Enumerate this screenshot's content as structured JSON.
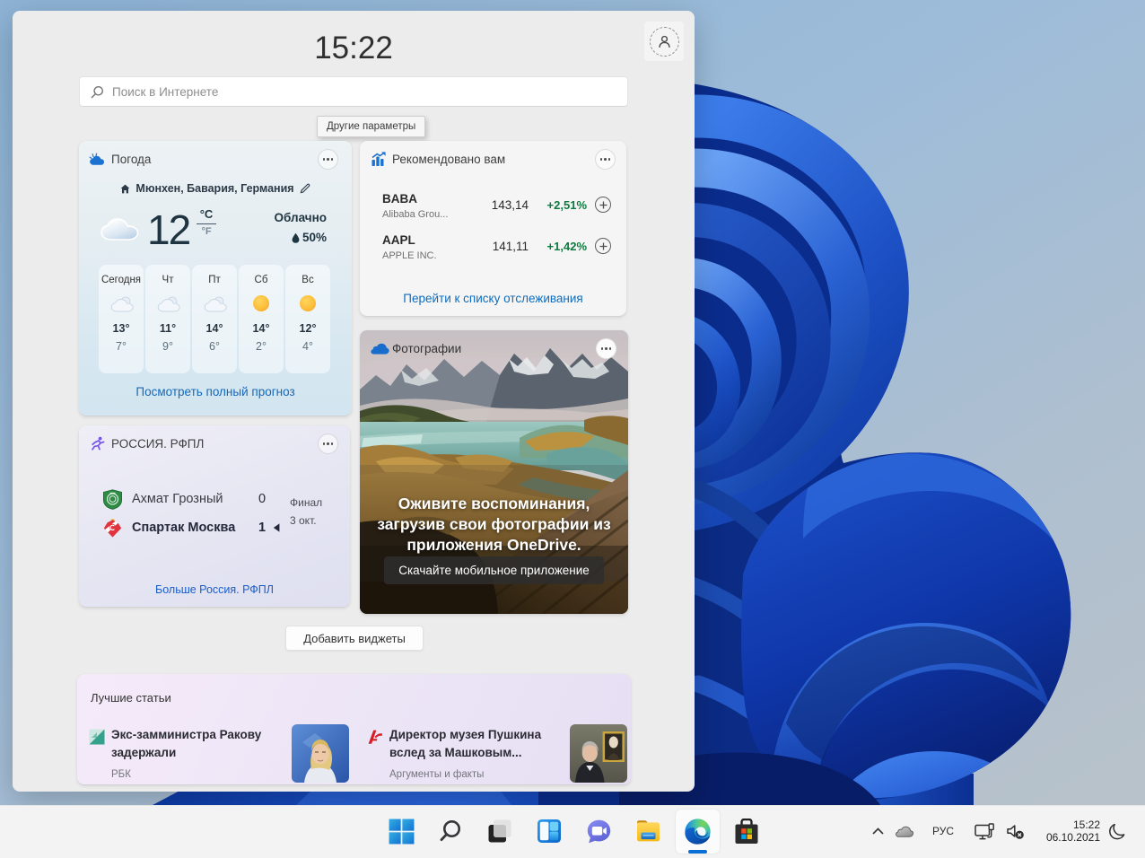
{
  "panel": {
    "time": "15:22",
    "search_placeholder": "Поиск в Интернете",
    "tooltip": "Другие параметры",
    "add_widgets_label": "Добавить виджеты"
  },
  "weather": {
    "title": "Погода",
    "location": "Мюнхен, Бавария, Германия",
    "temperature": "12",
    "unit_c": "°C",
    "unit_f": "°F",
    "condition": "Облачно",
    "precipitation": "50%",
    "forecast": [
      {
        "day": "Сегодня",
        "hi": "13°",
        "lo": "7°",
        "icon": "partly-cloudy"
      },
      {
        "day": "Чт",
        "hi": "11°",
        "lo": "9°",
        "icon": "partly-cloudy"
      },
      {
        "day": "Пт",
        "hi": "14°",
        "lo": "6°",
        "icon": "partly-cloudy"
      },
      {
        "day": "Сб",
        "hi": "14°",
        "lo": "2°",
        "icon": "sunny"
      },
      {
        "day": "Вс",
        "hi": "12°",
        "lo": "4°",
        "icon": "sunny"
      }
    ],
    "link": "Посмотреть полный прогноз"
  },
  "stocks": {
    "title": "Рекомендовано вам",
    "rows": [
      {
        "ticker": "BABA",
        "name": "Alibaba Grou...",
        "price": "143,14",
        "change": "+2,51%"
      },
      {
        "ticker": "AAPL",
        "name": "APPLE INC.",
        "price": "141,11",
        "change": "+1,42%"
      }
    ],
    "link": "Перейти к списку отслеживания",
    "change_color": "#0e7a40"
  },
  "sports": {
    "title": "РОССИЯ. РФПЛ",
    "team1": {
      "name": "Ахмат Грозный",
      "score": "0"
    },
    "team2": {
      "name": "Спартак Москва",
      "score": "1"
    },
    "status": "Финал",
    "date": "3 окт.",
    "link": "Больше Россия. РФПЛ"
  },
  "photos": {
    "title": "Фотографии",
    "message": "Оживите воспоминания, загрузив свои фотографии из приложения OneDrive.",
    "button": "Скачайте мобильное приложение"
  },
  "news": {
    "title": "Лучшие статьи",
    "articles": [
      {
        "headline": "Экс-замминистра Ракову задержали",
        "source": "РБК"
      },
      {
        "headline": "Директор музея Пушкина вслед за Машковым...",
        "source": "Аргументы и факты"
      }
    ]
  },
  "taskbar": {
    "language": "РУС",
    "time": "15:22",
    "date": "06.10.2021"
  },
  "colors": {
    "accent_blue": "#0b6fd6",
    "link_blue": "#0f6cbd",
    "positive_green": "#0e7a40"
  }
}
